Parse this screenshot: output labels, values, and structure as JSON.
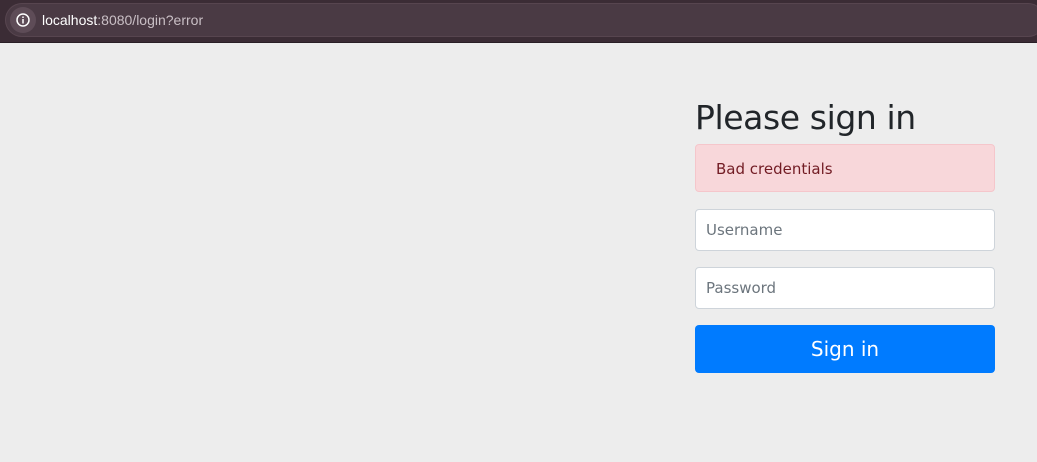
{
  "browser": {
    "url_host": "localhost",
    "url_rest": ":8080/login?error",
    "site_info_icon": "info-circle-icon"
  },
  "form": {
    "heading": "Please sign in",
    "error_message": "Bad credentials",
    "username_placeholder": "Username",
    "password_placeholder": "Password",
    "submit_label": "Sign in"
  },
  "colors": {
    "page_background": "#ededed",
    "browser_bar": "#3b2c35",
    "alert_background": "#f8d7da",
    "alert_text": "#721c24",
    "primary_button": "#007bff"
  }
}
